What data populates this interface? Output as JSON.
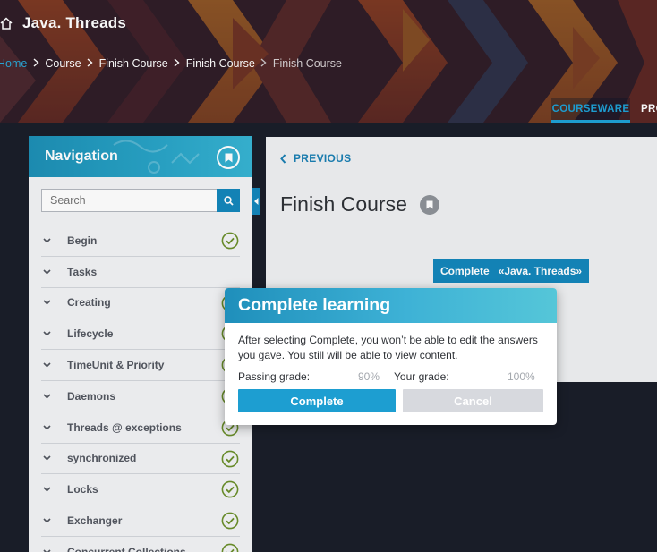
{
  "app": {
    "course_title": "Java. Threads"
  },
  "breadcrumb": [
    {
      "label": "Home",
      "state": "link"
    },
    {
      "label": "Course",
      "state": "normal"
    },
    {
      "label": "Finish Course",
      "state": "normal"
    },
    {
      "label": "Finish Course",
      "state": "normal"
    },
    {
      "label": "Finish Course",
      "state": "current"
    }
  ],
  "tabs": [
    {
      "label": "COURSEWARE",
      "active": true
    },
    {
      "label": "PROGRESS",
      "active": false
    }
  ],
  "sidebar": {
    "title": "Navigation",
    "search_placeholder": "Search",
    "items": [
      {
        "label": "Begin",
        "completed": true
      },
      {
        "label": "Tasks",
        "completed": false
      },
      {
        "label": "Creating",
        "completed": true
      },
      {
        "label": "Lifecycle",
        "completed": true
      },
      {
        "label": "TimeUnit & Priority",
        "completed": true
      },
      {
        "label": "Daemons",
        "completed": true
      },
      {
        "label": "Threads @ exceptions",
        "completed": true
      },
      {
        "label": "synchronized",
        "completed": true
      },
      {
        "label": "Locks",
        "completed": true
      },
      {
        "label": "Exchanger",
        "completed": true
      },
      {
        "label": "Concurrent Collections",
        "completed": true
      }
    ]
  },
  "content": {
    "previous_label": "PREVIOUS",
    "unit_title": "Finish Course",
    "complete_button": {
      "action": "Complete",
      "course": "«Java. Threads»"
    }
  },
  "modal": {
    "title": "Complete learning",
    "message": "After selecting Complete, you won’t be able to edit the answers you gave. You still will be able to view content.",
    "passing_grade_label": "Passing grade:",
    "passing_grade_value": "90%",
    "your_grade_label": "Your grade:",
    "your_grade_value": "100%",
    "confirm_label": "Complete",
    "cancel_label": "Cancel"
  },
  "colors": {
    "accent": "#1d9ed1",
    "accent_dark": "#1487bb",
    "check_green": "#6b8f2b",
    "page_dark": "#1a1e2a"
  }
}
